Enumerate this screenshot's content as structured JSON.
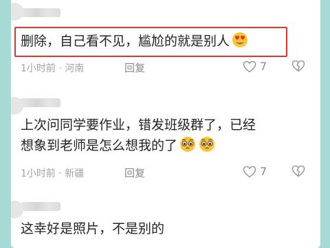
{
  "comments": [
    {
      "text": "删除，自己看不见，尴尬的就是别人",
      "emoji": [
        "heart-eyes-emoji"
      ],
      "time": "1小时前",
      "separator": "·",
      "location": "河南",
      "reply_label": "回复",
      "likes": "7",
      "highlighted": true,
      "highlight_color": "#e8332a"
    },
    {
      "text_line1": "上次问同学要作业，错发班级群了，已经",
      "text_line2": "想象到老师是怎么想我的了",
      "emoji": [
        "pleading-face-emoji",
        "pleading-face-emoji"
      ],
      "time": "1小时前",
      "separator": "·",
      "location": "新疆",
      "reply_label": "回复",
      "likes": "7"
    },
    {
      "text": "这幸好是照片，不是别的"
    }
  ],
  "icons": {
    "like": "heart-outline-icon",
    "dislike": "broken-heart-icon"
  },
  "colors": {
    "background": "#a6dad4",
    "text": "#222222",
    "meta": "#a2a2a2"
  }
}
